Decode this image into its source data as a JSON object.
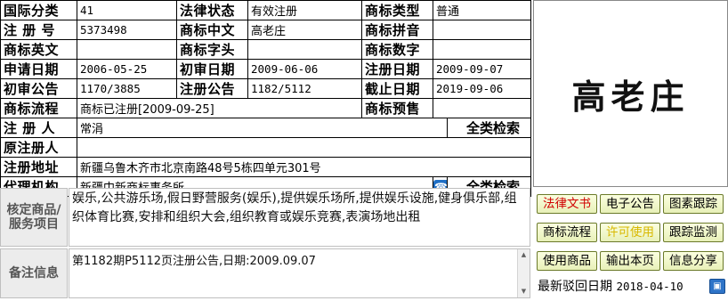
{
  "labels": {
    "intl_class": "国际分类",
    "reg_no": "注 册 号",
    "mark_en": "商标英文",
    "apply_date": "申请日期",
    "prelim_notice": "初审公告",
    "mark_process": "商标流程",
    "registrant": "注 册 人",
    "orig_registrant": "原注册人",
    "reg_address": "注册地址",
    "agency": "代理机构",
    "legal_status": "法律状态",
    "mark_cn": "商标中文",
    "mark_initial": "商标字头",
    "prelim_date": "初审日期",
    "reg_notice": "注册公告",
    "mark_type": "商标类型",
    "mark_pinyin": "商标拼音",
    "mark_digits": "商标数字",
    "reg_date": "注册日期",
    "expiry_date": "截止日期",
    "mark_presale": "商标预售",
    "services_label": "核定商品/服务项目",
    "remarks_label": "备注信息"
  },
  "record": {
    "intl_class": "41",
    "legal_status": "有效注册",
    "mark_type": "普通",
    "reg_no": "5373498",
    "mark_cn": "高老庄",
    "mark_pinyin": "",
    "mark_en": "",
    "mark_initial": "",
    "mark_digits": "",
    "apply_date": "2006-05-25",
    "prelim_date": "2009-06-06",
    "reg_date": "2009-09-07",
    "prelim_notice": "1170/3885",
    "reg_notice": "1182/5112",
    "expiry_date": "2019-09-06",
    "mark_process": "商标已注册[2009-09-25]",
    "mark_presale": "",
    "registrant": "常涓",
    "orig_registrant": "",
    "reg_address": "新疆乌鲁木齐市北京南路48号5栋四单元301号",
    "agency": "新疆中新商标事务所",
    "all_class_search": "全类检索"
  },
  "mark_image_text": "高老庄",
  "services_text": "娱乐,公共游乐场,假日野营服务(娱乐),提供娱乐场所,提供娱乐设施,健身俱乐部,组织体育比赛,安排和组织大会,组织教育或娱乐竞赛,表演场地出租",
  "remarks_text": "第1182期P5112页注册公告,日期:2009.09.07",
  "buttons": {
    "legal_docs": "法律文书",
    "e_notice": "电子公告",
    "image_trace": "图素跟踪",
    "mark_flow": "商标流程",
    "license_use": "许可使用",
    "trace_monitor": "跟踪监测",
    "use_goods": "使用商品",
    "output_page": "输出本页",
    "share_info": "信息分享"
  },
  "reject": {
    "label": "最新驳回日期",
    "date": "2018-04-10"
  },
  "colors": {
    "button_bg": "#f1f6c8",
    "red_text": "#d00000",
    "yellow_text": "#d8b800",
    "label_gray": "#555555",
    "phone_blue": "#1f6fc5"
  },
  "icons": {
    "phone": "phone-icon",
    "help": "help-icon",
    "scroll_up": "scroll-up-arrow-icon",
    "scroll_down": "scroll-down-arrow-icon"
  }
}
